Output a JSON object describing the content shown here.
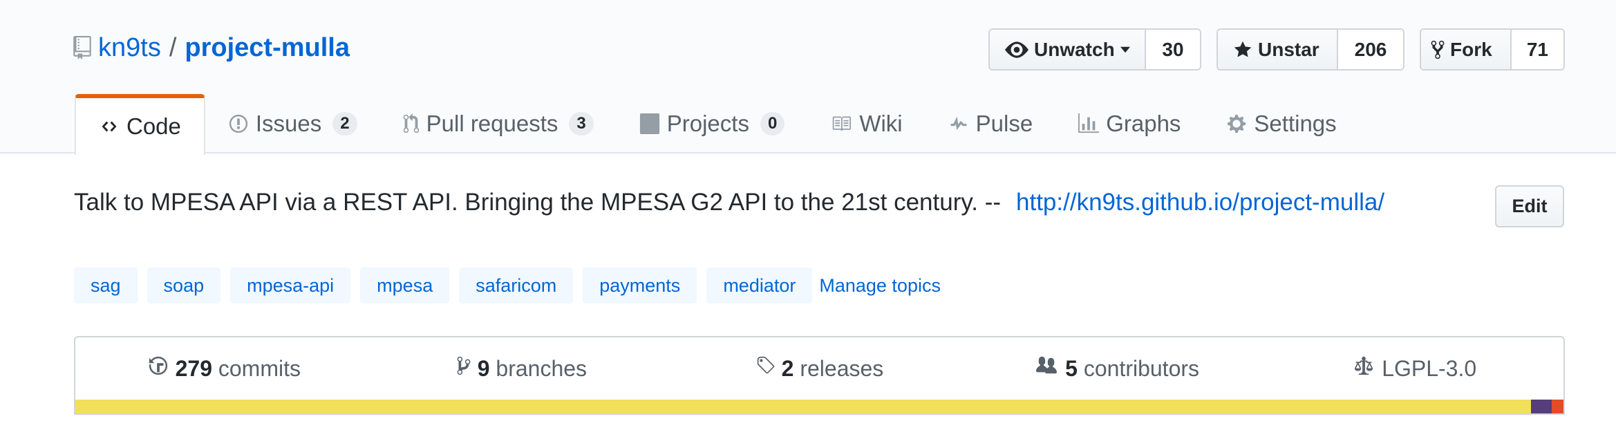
{
  "repo": {
    "owner": "kn9ts",
    "separator": "/",
    "name": "project-mulla"
  },
  "social": {
    "watch": {
      "label": "Unwatch",
      "count": "30"
    },
    "star": {
      "label": "Unstar",
      "count": "206"
    },
    "fork": {
      "label": "Fork",
      "count": "71"
    }
  },
  "tabs": [
    {
      "label": "Code",
      "icon": "code-icon"
    },
    {
      "label": "Issues",
      "count": "2",
      "icon": "issue-icon"
    },
    {
      "label": "Pull requests",
      "count": "3",
      "icon": "pull-request-icon"
    },
    {
      "label": "Projects",
      "count": "0",
      "icon": "project-icon"
    },
    {
      "label": "Wiki",
      "icon": "book-icon"
    },
    {
      "label": "Pulse",
      "icon": "pulse-icon"
    },
    {
      "label": "Graphs",
      "icon": "graph-icon"
    },
    {
      "label": "Settings",
      "icon": "gear-icon"
    }
  ],
  "description": {
    "text": "Talk to MPESA API via a REST API. Bringing the MPESA G2 API to the 21st century. --",
    "link": "http://kn9ts.github.io/project-mulla/"
  },
  "edit_label": "Edit",
  "topics": [
    "sag",
    "soap",
    "mpesa-api",
    "mpesa",
    "safaricom",
    "payments",
    "mediator"
  ],
  "manage_topics_label": "Manage topics",
  "stats": {
    "commits": {
      "count": "279",
      "label": "commits"
    },
    "branches": {
      "count": "9",
      "label": "branches"
    },
    "releases": {
      "count": "2",
      "label": "releases"
    },
    "contributors": {
      "count": "5",
      "label": "contributors"
    },
    "license": {
      "label": "LGPL-3.0"
    }
  },
  "language_bar": [
    {
      "color": "#f1e05a",
      "share": 0.978
    },
    {
      "color": "#563d7c",
      "share": 0.014
    },
    {
      "color": "#e34c26",
      "share": 0.008
    }
  ],
  "colors": {
    "accent_link": "#0366d6",
    "active_tab_border": "#e36209"
  }
}
